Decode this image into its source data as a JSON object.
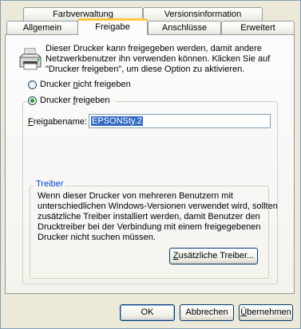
{
  "tabs": {
    "row_back": [
      {
        "label": "Farbverwaltung"
      },
      {
        "label": "Versionsinformation"
      }
    ],
    "row_front": [
      {
        "label": "Allgemein"
      },
      {
        "label": "Freigabe",
        "active": true
      },
      {
        "label": "Anschlüsse"
      },
      {
        "label": "Erweitert"
      }
    ]
  },
  "sharing": {
    "description_lines": [
      "Dieser Drucker kann freigegeben werden, damit andere",
      "Netzwerkbenutzer ihn verwenden können. Klicken Sie auf",
      "\"Drucker freigeben\", um diese Option zu aktivieren."
    ],
    "radio_not_shared": {
      "label_pre": "Drucker ",
      "label_key": "n",
      "label_post": "icht freigeben",
      "checked": false
    },
    "radio_shared": {
      "label_pre": "Drucker ",
      "label_key": "f",
      "label_post": "reigeben",
      "checked": true
    },
    "share_name_label_key": "F",
    "share_name_label_rest": "reigabename:",
    "share_name_value": "EPSONSty.2"
  },
  "drivers": {
    "group_title": "Treiber",
    "text_lines": [
      "Wenn dieser Drucker von mehreren Benutzern mit",
      "unterschiedlichen Windows-Versionen verwendet wird, sollten",
      "zusätzliche Treiber installiert werden, damit Benutzer den",
      "Drucktreiber bei der Verbindung mit einem freigegebenen",
      "Drucker nicht suchen müssen."
    ],
    "button_key": "Z",
    "button_rest": "usätzliche Treiber..."
  },
  "footer": {
    "ok": "OK",
    "cancel": "Abbrechen",
    "apply_key": "Ü",
    "apply_rest": "bernehmen"
  },
  "colors": {
    "dialog_bg": "#ece9d8",
    "active_tab_accent": "#ffc83c",
    "selection": "#316ac5",
    "group_title": "#0046d5"
  },
  "icons": {
    "printer": "printer-icon",
    "radio": "radio-button"
  }
}
